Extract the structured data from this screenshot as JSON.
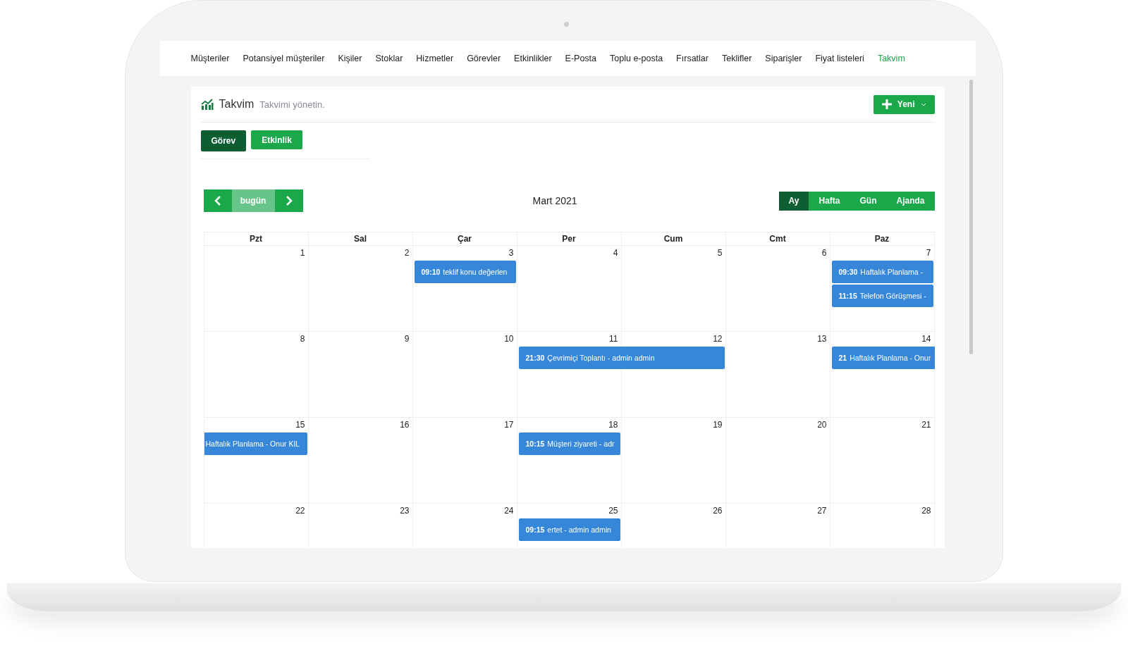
{
  "nav": {
    "items": [
      {
        "label": "Müşteriler",
        "selected": false
      },
      {
        "label": "Potansiyel müşteriler",
        "selected": false
      },
      {
        "label": "Kişiler",
        "selected": false
      },
      {
        "label": "Stoklar",
        "selected": false
      },
      {
        "label": "Hizmetler",
        "selected": false
      },
      {
        "label": "Görevler",
        "selected": false
      },
      {
        "label": "Etkinlikler",
        "selected": false
      },
      {
        "label": "E-Posta",
        "selected": false
      },
      {
        "label": "Toplu e-posta",
        "selected": false
      },
      {
        "label": "Fırsatlar",
        "selected": false
      },
      {
        "label": "Teklifler",
        "selected": false
      },
      {
        "label": "Siparişler",
        "selected": false
      },
      {
        "label": "Fiyat listeleri",
        "selected": false
      },
      {
        "label": "Takvim",
        "selected": true
      }
    ]
  },
  "header": {
    "title": "Takvim",
    "subtitle": "Takvimi yönetin.",
    "new_button": "Yeni"
  },
  "filters": [
    {
      "label": "Görev",
      "selected": true
    },
    {
      "label": "Etkinlik",
      "selected": false
    }
  ],
  "toolbar": {
    "today": "bugün",
    "title": "Mart 2021",
    "views": [
      {
        "label": "Ay",
        "selected": true
      },
      {
        "label": "Hafta",
        "selected": false
      },
      {
        "label": "Gün",
        "selected": false
      },
      {
        "label": "Ajanda",
        "selected": false
      }
    ]
  },
  "calendar": {
    "weekdays": [
      "Pzt",
      "Sal",
      "Çar",
      "Per",
      "Cum",
      "Cmt",
      "Paz"
    ],
    "weeks": [
      {
        "days": [
          {
            "number": "1"
          },
          {
            "number": "2"
          },
          {
            "number": "3",
            "events": [
              {
                "time": "09:10",
                "title": "teklif konu değerlen"
              }
            ]
          },
          {
            "number": "4"
          },
          {
            "number": "5"
          },
          {
            "number": "6"
          },
          {
            "number": "7",
            "events": [
              {
                "time": "09:30",
                "title": "Haftalık Planlama -"
              },
              {
                "time": "11:15",
                "title": "Telefon Görüşmesi -"
              }
            ]
          }
        ]
      },
      {
        "days": [
          {
            "number": "8"
          },
          {
            "number": "9"
          },
          {
            "number": "10"
          },
          {
            "number": "11",
            "events": [
              {
                "time": "21:30",
                "title": "Çevrimiçi Toplantı - admin admin",
                "multi_day": true
              }
            ]
          },
          {
            "number": "12"
          },
          {
            "number": "13"
          },
          {
            "number": "14",
            "events": [
              {
                "time": "21",
                "title": "Haftalık Planlama - Onur",
                "continues": true
              }
            ]
          }
        ]
      },
      {
        "days": [
          {
            "number": "15",
            "events": [
              {
                "title": "Haftalık Planlama - Onur KIL",
                "continued": true
              }
            ]
          },
          {
            "number": "16"
          },
          {
            "number": "17"
          },
          {
            "number": "18",
            "events": [
              {
                "time": "10:15",
                "title": "Müşteri ziyareti - adr"
              }
            ]
          },
          {
            "number": "19"
          },
          {
            "number": "20"
          },
          {
            "number": "21"
          }
        ]
      },
      {
        "days": [
          {
            "number": "22"
          },
          {
            "number": "23"
          },
          {
            "number": "24"
          },
          {
            "number": "25",
            "events": [
              {
                "time": "09:15",
                "title": "ertet - admin admin"
              }
            ]
          },
          {
            "number": "26"
          },
          {
            "number": "27"
          },
          {
            "number": "28"
          }
        ]
      }
    ]
  }
}
